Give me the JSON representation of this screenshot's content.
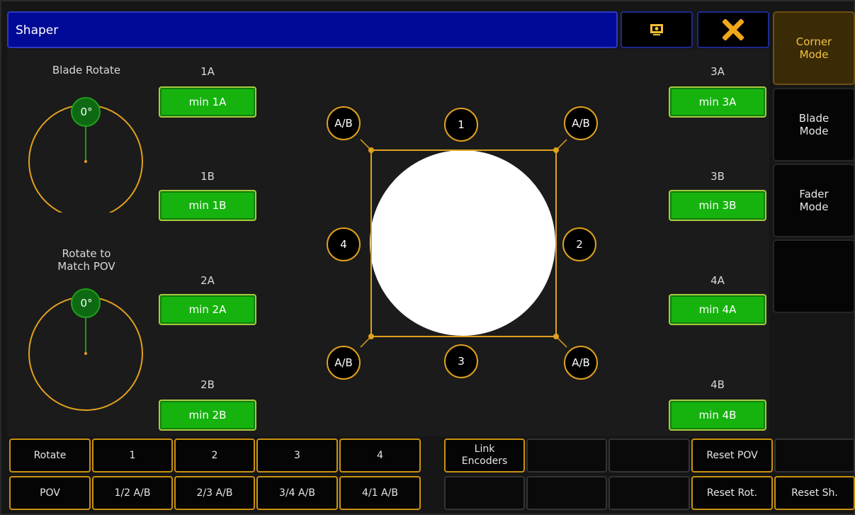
{
  "window": {
    "title": "Shaper",
    "title_icons": [
      "screenshot-icon",
      "close-icon"
    ]
  },
  "side_buttons": [
    {
      "label": "Corner\nMode",
      "active": true
    },
    {
      "label": "Blade\nMode",
      "active": false
    },
    {
      "label": "Fader\nMode",
      "active": false
    },
    {
      "label": "",
      "active": false
    }
  ],
  "encoders": {
    "blade_rotate": {
      "label": "Blade Rotate",
      "value": "0°"
    },
    "rotate_pov": {
      "label": "Rotate to\nMatch POV",
      "value": "0°"
    }
  },
  "blades_left": [
    {
      "label": "1A",
      "button": "min 1A"
    },
    {
      "label": "1B",
      "button": "min 1B"
    },
    {
      "label": "2A",
      "button": "min 2A"
    },
    {
      "label": "2B",
      "button": "min 2B"
    }
  ],
  "blades_right": [
    {
      "label": "3A",
      "button": "min 3A"
    },
    {
      "label": "3B",
      "button": "min 3B"
    },
    {
      "label": "4A",
      "button": "min 4A"
    },
    {
      "label": "4B",
      "button": "min 4B"
    }
  ],
  "shaper_badges": {
    "top": "1",
    "right": "2",
    "bottom": "3",
    "left": "4",
    "corner": "A/B"
  },
  "bottom_grid": {
    "row1": [
      "Rotate",
      "1",
      "2",
      "3",
      "4",
      "Link\nEncoders",
      "",
      "",
      "Reset POV",
      ""
    ],
    "row2": [
      "POV",
      "1/2 A/B",
      "2/3 A/B",
      "3/4 A/B",
      "4/1 A/B",
      "",
      "",
      "",
      "Reset Rot.",
      "Reset Sh."
    ]
  },
  "colors": {
    "accent": "#e0a11e",
    "title_bar": "#000a96",
    "min_button": "#16b30f",
    "active_mode_text": "#f2c23e"
  }
}
